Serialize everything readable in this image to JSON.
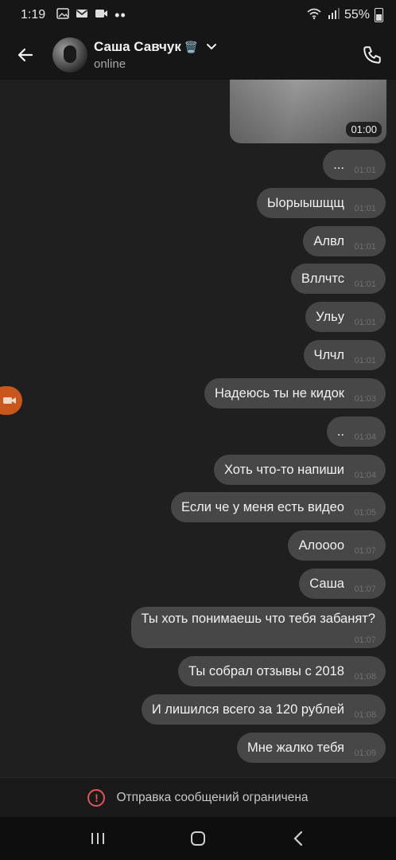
{
  "status_bar": {
    "time": "1:19",
    "icons": [
      "image-icon",
      "mail-icon",
      "video-icon",
      "more-dots"
    ],
    "battery": "55%"
  },
  "header": {
    "contact_name": "Саша Савчук",
    "name_emoji": "🗑️",
    "presence": "online"
  },
  "chat": {
    "media": {
      "duration": "01:00"
    },
    "messages": [
      {
        "text": "...",
        "time": "01:01"
      },
      {
        "text": "Ыорыышщщ",
        "time": "01:01"
      },
      {
        "text": "Алвл",
        "time": "01:01"
      },
      {
        "text": "Вллчтс",
        "time": "01:01"
      },
      {
        "text": "Ульу",
        "time": "01:01"
      },
      {
        "text": "Члчл",
        "time": "01:01"
      },
      {
        "text": "Надеюсь ты не кидок",
        "time": "01:03"
      },
      {
        "text": "..",
        "time": "01:04"
      },
      {
        "text": "Хоть что-то напиши",
        "time": "01:04"
      },
      {
        "text": "Если че у меня есть видео",
        "time": "01:05"
      },
      {
        "text": "Алоооо",
        "time": "01:07"
      },
      {
        "text": "Саша",
        "time": "01:07"
      },
      {
        "text": "Ты хоть понимаешь что тебя забанят?",
        "time": "01:07"
      },
      {
        "text": "Ты собрал отзывы с 2018",
        "time": "01:08"
      },
      {
        "text": "И лишился всего за 120 рублей",
        "time": "01:08"
      },
      {
        "text": "Мне жалко тебя",
        "time": "01:09"
      }
    ]
  },
  "restricted": {
    "message": "Отправка сообщений ограничена"
  },
  "colors": {
    "bubble": "#474747",
    "background": "#1f1f1f",
    "accent_camera": "#c9561a",
    "warning": "#e05555"
  }
}
